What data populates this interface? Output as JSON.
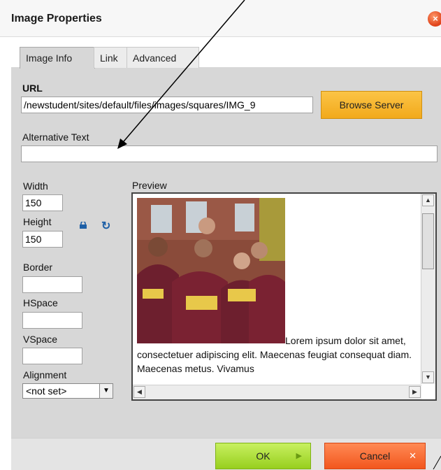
{
  "dialog": {
    "title": "Image Properties"
  },
  "tabs": [
    {
      "label": "Image Info",
      "active": true
    },
    {
      "label": "Link",
      "active": false
    },
    {
      "label": "Advanced",
      "active": false
    }
  ],
  "url": {
    "label": "URL",
    "value": "/newstudent/sites/default/files/images/squares/IMG_9"
  },
  "browse_button": "Browse Server",
  "alt_text": {
    "label": "Alternative Text",
    "value": ""
  },
  "width": {
    "label": "Width",
    "value": "150"
  },
  "height": {
    "label": "Height",
    "value": "150"
  },
  "border": {
    "label": "Border",
    "value": ""
  },
  "hspace": {
    "label": "HSpace",
    "value": ""
  },
  "vspace": {
    "label": "VSpace",
    "value": ""
  },
  "alignment": {
    "label": "Alignment",
    "value": "<not set>"
  },
  "preview": {
    "label": "Preview",
    "text": "Lorem ipsum dolor sit amet, consectetuer adipiscing elit. Maecenas feugiat consequat diam. Maecenas metus. Vivamus"
  },
  "footer": {
    "ok": "OK",
    "cancel": "Cancel"
  },
  "colors": {
    "ok": "#97cf1e",
    "cancel": "#f2561d",
    "browse": "#f2a91b",
    "panel": "#d7d7d7"
  }
}
